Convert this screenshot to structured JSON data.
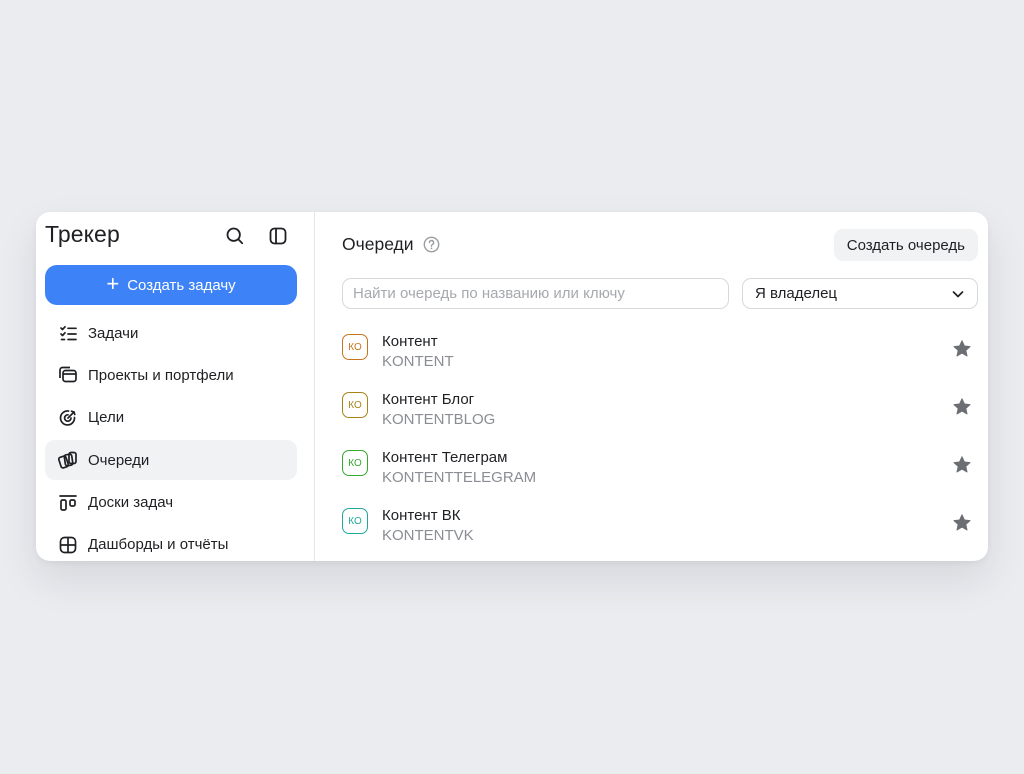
{
  "sidebar": {
    "brand": "Трекер",
    "create_task_label": "Создать задачу",
    "items": [
      {
        "label": "Задачи",
        "icon": "tasks-icon"
      },
      {
        "label": "Проекты и портфели",
        "icon": "projects-icon"
      },
      {
        "label": "Цели",
        "icon": "goals-icon"
      },
      {
        "label": "Очереди",
        "icon": "queues-icon",
        "active": true
      },
      {
        "label": "Доски задач",
        "icon": "boards-icon"
      },
      {
        "label": "Дашборды и отчёты",
        "icon": "dashboards-icon"
      }
    ]
  },
  "main": {
    "title": "Очереди",
    "create_queue_label": "Создать очередь",
    "search_placeholder": "Найти очередь по названию или ключу",
    "search_value": "",
    "filter_selected": "Я владелец",
    "queues": [
      {
        "avatar": "КО",
        "name": "Контент",
        "key": "KONTENT",
        "color": "#c8741b",
        "starred": true
      },
      {
        "avatar": "КО",
        "name": "Контент Блог",
        "key": "KONTENTBLOG",
        "color": "#a88416",
        "starred": true
      },
      {
        "avatar": "КО",
        "name": "Контент Телеграм",
        "key": "KONTENTTELEGRAM",
        "color": "#35a82f",
        "starred": true
      },
      {
        "avatar": "КО",
        "name": "Контент ВК",
        "key": "KONTENTVK",
        "color": "#22a89a",
        "starred": true
      }
    ]
  },
  "colors": {
    "accent": "#3d82f6",
    "background": "#ebecf0",
    "active_nav": "#f1f2f4",
    "star": "#6b6e73"
  }
}
